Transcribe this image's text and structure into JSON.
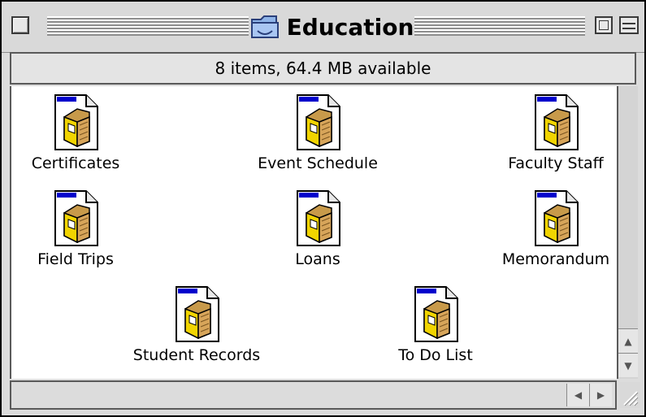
{
  "window": {
    "title": "Education",
    "title_icon": "folder-icon"
  },
  "header": {
    "status": "8 items, 64.4 MB available"
  },
  "items": [
    {
      "label": "Certificates",
      "icon": "filemaker-document-icon"
    },
    {
      "label": "Event Schedule",
      "icon": "filemaker-document-icon"
    },
    {
      "label": "Faculty Staff",
      "icon": "filemaker-document-icon"
    },
    {
      "label": "Field Trips",
      "icon": "filemaker-document-icon"
    },
    {
      "label": "Loans",
      "icon": "filemaker-document-icon"
    },
    {
      "label": "Memorandum",
      "icon": "filemaker-document-icon"
    },
    {
      "label": "Student Records",
      "icon": "filemaker-document-icon"
    },
    {
      "label": "To Do List",
      "icon": "filemaker-document-icon"
    }
  ],
  "scrollbars": {
    "up_arrow": "▲",
    "down_arrow": "▼",
    "left_arrow": "◀",
    "right_arrow": "▶"
  }
}
